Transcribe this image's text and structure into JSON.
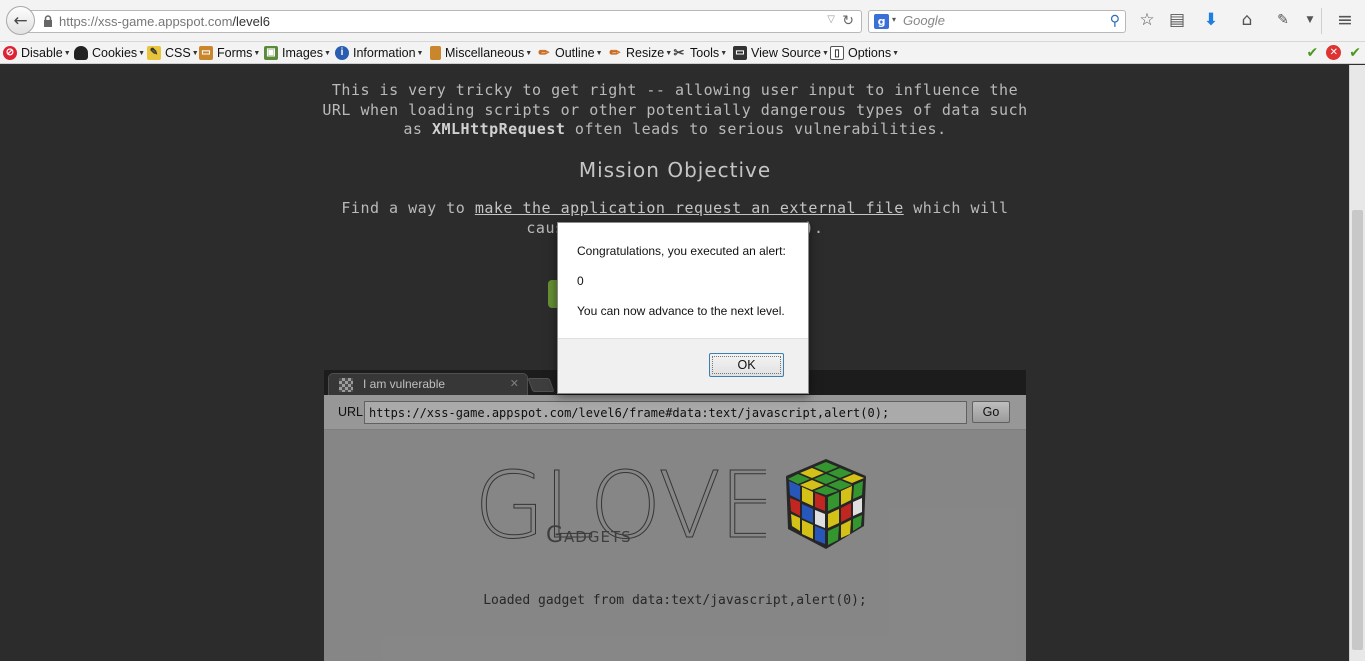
{
  "browser": {
    "url_host": "https://xss-game.appspot.com",
    "url_path": "/level6",
    "search_placeholder": "Google"
  },
  "webdev_toolbar": {
    "items": [
      "Disable",
      "Cookies",
      "CSS",
      "Forms",
      "Images",
      "Information",
      "Miscellaneous",
      "Outline",
      "Resize",
      "Tools",
      "View Source",
      "Options"
    ]
  },
  "page": {
    "intro_line1": "This is very tricky to get right -- allowing user input to influence the",
    "intro_line2": "URL when loading scripts or other potentially dangerous types of data such",
    "intro_line3_pre": "as ",
    "intro_line3_bold": "XMLHttpRequest",
    "intro_line3_post": " often leads to serious vulnerabilities.",
    "mission_heading": "Mission Objective",
    "objective_pre": "Find a way to ",
    "objective_link": "make the application request an external file",
    "objective_post": " which will",
    "objective_line2_left": "caus",
    "objective_line2_right": ")."
  },
  "mini_browser": {
    "tab_title": "I am vulnerable",
    "url_label": "URL",
    "url_value": "https://xss-game.appspot.com/level6/frame#data:text/javascript,alert(0);",
    "go_label": "Go",
    "logo_word": "GLOVE",
    "logo_sub": "Gadgets",
    "loaded_message": "Loaded gadget from data:text/javascript,alert(0);"
  },
  "alert": {
    "line1": "Congratulations, you executed an alert:",
    "line2": "0",
    "line3": "You can now advance to the next level.",
    "ok_label": "OK"
  },
  "colors": {
    "page_bg": "#303030",
    "accent_green": "#6f9f3a",
    "downloads_blue": "#1d7fe0"
  }
}
